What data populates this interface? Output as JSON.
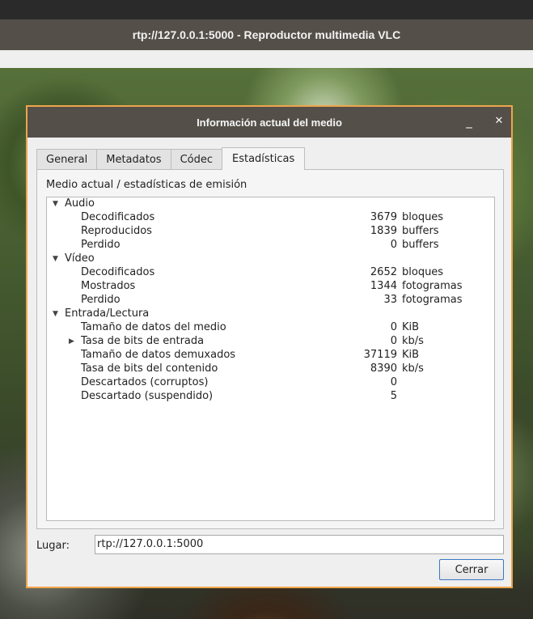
{
  "window": {
    "title": "rtp://127.0.0.1:5000 - Reproductor multimedia VLC"
  },
  "dialog": {
    "title": "Información actual del medio",
    "minimize_glyph": "_",
    "close_glyph": "✕",
    "tabs": [
      {
        "label": "General"
      },
      {
        "label": "Metadatos"
      },
      {
        "label": "Códec"
      },
      {
        "label": "Estadísticas"
      }
    ],
    "active_tab": "Estadísticas",
    "panel_label": "Medio actual / estadísticas de emisión",
    "groups": [
      {
        "label": "Audio",
        "items": [
          {
            "label": "Decodificados",
            "value": "3679",
            "unit": "bloques"
          },
          {
            "label": "Reproducidos",
            "value": "1839",
            "unit": "buffers"
          },
          {
            "label": "Perdido",
            "value": "0",
            "unit": "buffers"
          }
        ]
      },
      {
        "label": "Vídeo",
        "items": [
          {
            "label": "Decodificados",
            "value": "2652",
            "unit": "bloques"
          },
          {
            "label": "Mostrados",
            "value": "1344",
            "unit": "fotogramas"
          },
          {
            "label": "Perdido",
            "value": "33",
            "unit": "fotogramas"
          }
        ]
      },
      {
        "label": "Entrada/Lectura",
        "items": [
          {
            "label": "Tamaño de datos del medio",
            "value": "0",
            "unit": "KiB"
          },
          {
            "label": "Tasa de bits de entrada",
            "value": "0",
            "unit": "kb/s"
          },
          {
            "label": "Tamaño de datos demuxados",
            "value": "37119",
            "unit": "KiB"
          },
          {
            "label": "Tasa de bits del contenido",
            "value": "8390",
            "unit": "kb/s"
          },
          {
            "label": "Descartados (corruptos)",
            "value": "0",
            "unit": ""
          },
          {
            "label": "Descartado (suspendido)",
            "value": "5",
            "unit": ""
          }
        ]
      }
    ],
    "place_label": "Lugar:",
    "place_value": "rtp://127.0.0.1:5000",
    "close_button": "Cerrar"
  }
}
